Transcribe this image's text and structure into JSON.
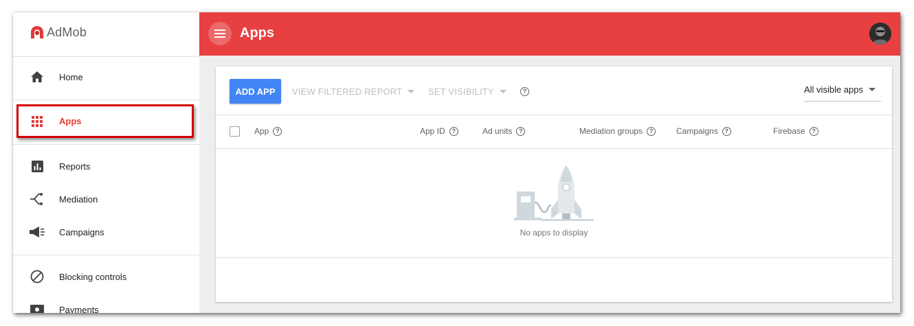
{
  "app": {
    "brand": "AdMob"
  },
  "header": {
    "title": "Apps"
  },
  "sidebar": {
    "items": [
      {
        "label": "Home",
        "icon": "home-icon"
      },
      {
        "label": "Apps",
        "icon": "apps-grid-icon",
        "active": true
      },
      {
        "label": "Reports",
        "icon": "reports-icon"
      },
      {
        "label": "Mediation",
        "icon": "mediation-icon"
      },
      {
        "label": "Campaigns",
        "icon": "campaigns-icon"
      },
      {
        "label": "Blocking controls",
        "icon": "blocking-icon"
      },
      {
        "label": "Payments",
        "icon": "payments-icon"
      }
    ]
  },
  "toolbar": {
    "add_app": "ADD APP",
    "view_filtered_report": "VIEW FILTERED REPORT",
    "set_visibility": "SET VISIBILITY",
    "filter_value": "All visible apps"
  },
  "table": {
    "columns": [
      "App",
      "App ID",
      "Ad units",
      "Mediation groups",
      "Campaigns",
      "Firebase"
    ],
    "empty_message": "No apps to display"
  },
  "colors": {
    "header_red": "#e84040",
    "primary_blue": "#4285f4",
    "active_red": "#e53935",
    "highlight_box": "#d50000"
  }
}
